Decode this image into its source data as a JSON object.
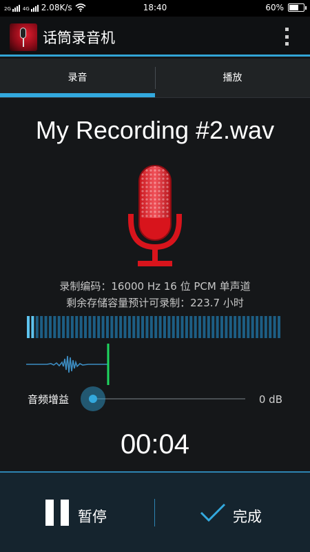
{
  "status_bar": {
    "network_speed": "2.08K/s",
    "time": "18:40",
    "battery": "60%",
    "signal_labels": [
      "2G",
      "4G"
    ],
    "icons": [
      "signal-icon",
      "wifi-icon",
      "battery-icon"
    ]
  },
  "app": {
    "title": "话筒录音机",
    "icon": "microphone-app-icon",
    "menu_icon": "overflow-menu-icon"
  },
  "tabs": [
    {
      "label": "录音",
      "active": true
    },
    {
      "label": "播放",
      "active": false
    }
  ],
  "recording": {
    "file_name": "My Recording #2.wav",
    "encoding_line": "录制编码：16000 Hz 16 位 PCM 单声道",
    "storage_line": "剩余存储容量预计可录制：223.7 小时",
    "level_meter_fraction": 0.04,
    "gain_label": "音频增益",
    "gain_value": "0 dB",
    "elapsed": "00:04"
  },
  "controls": {
    "pause_label": "暂停",
    "done_label": "完成"
  },
  "colors": {
    "accent": "#33a9de",
    "mic_red": "#e11b22",
    "waveform": "#3d8ec4",
    "playhead": "#1ed760",
    "bottom_bar": "#15242e"
  }
}
